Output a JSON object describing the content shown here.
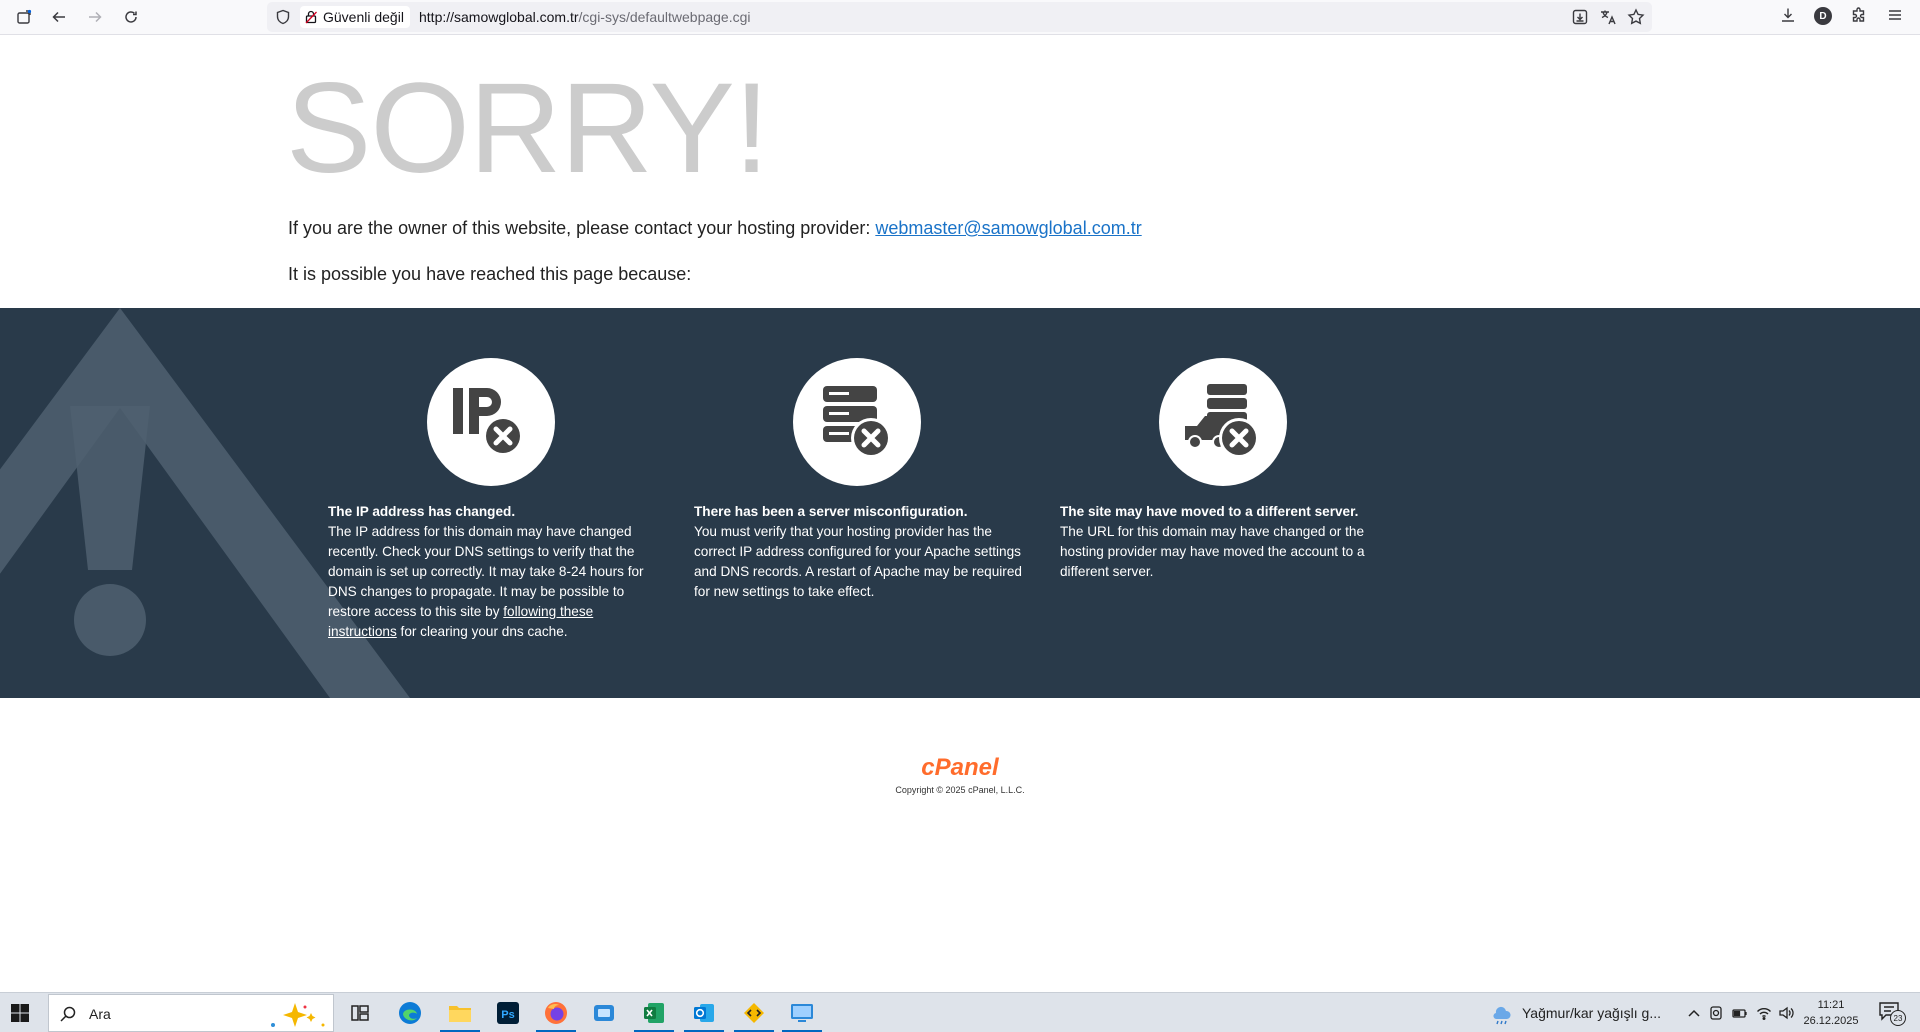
{
  "browser": {
    "security_label": "Güvenli değil",
    "url_host": "http://samowglobal.com.tr",
    "url_path": "/cgi-sys/defaultwebpage.cgi",
    "profile_initial": "D"
  },
  "page": {
    "title": "SORRY!",
    "owner_text": "If you are the owner of this website, please contact your hosting provider: ",
    "contact_email": "webmaster@samowglobal.com.tr",
    "reason_intro": "It is possible you have reached this page because:",
    "reasons": [
      {
        "icon": "ip-error-icon",
        "heading": "The IP address has changed.",
        "body": "The IP address for this domain may have changed recently. Check your DNS settings to verify that the domain is set up correctly. It may take 8-24 hours for DNS changes to propagate. It may be possible to restore access to this site by ",
        "link": "following these instructions",
        "body_after": " for clearing your dns cache."
      },
      {
        "icon": "server-error-icon",
        "heading": "There has been a server misconfiguration.",
        "body": "You must verify that your hosting provider has the correct IP address configured for your Apache settings and DNS records. A restart of Apache may be required for new settings to take effect."
      },
      {
        "icon": "moved-server-icon",
        "heading": "The site may have moved to a different server.",
        "body": "The URL for this domain may have changed or the hosting provider may have moved the account to a different server."
      }
    ],
    "footer_brand": "cPanel",
    "copyright": "Copyright © 2025 cPanel, L.L.C."
  },
  "taskbar": {
    "search_placeholder": "Ara",
    "weather": "Yağmur/kar yağışlı g...",
    "time": "11:21",
    "date": "26.12.2025",
    "notifications": "23"
  },
  "colors": {
    "banner": "#293a4a",
    "link": "#1a73c8",
    "title": "#cccccc",
    "cpanel_orange": "#ff6c2c"
  }
}
